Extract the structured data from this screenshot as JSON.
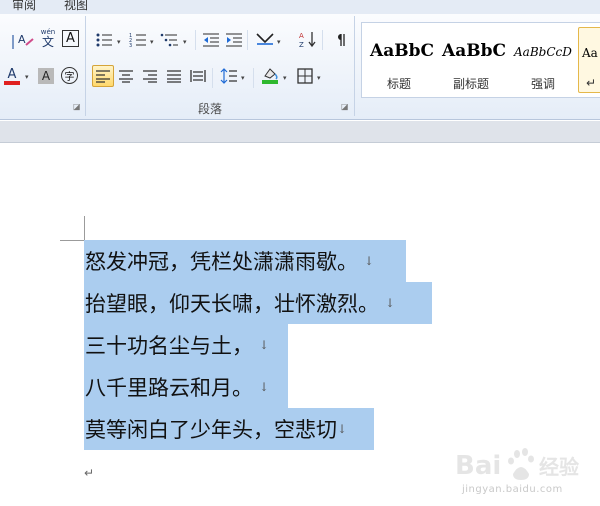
{
  "tabs": {
    "review": "审阅",
    "view": "视图"
  },
  "ribbon": {
    "paragraph_group_label": "段落",
    "font_group_partial": {
      "phonetic_label": "wén",
      "char_border_label": "A",
      "font_color_label": "A",
      "shade_label": "A",
      "enclose_label": "字"
    },
    "font_color_hex": "#e02020",
    "highlight_hex": "#2eb82e"
  },
  "styles": {
    "items": [
      {
        "sample": "AaBbC",
        "name": "标题"
      },
      {
        "sample": "AaBbC",
        "name": "副标题"
      },
      {
        "sample": "AaBbCcD",
        "name": "强调"
      },
      {
        "sample": "Aa",
        "name": "↵"
      }
    ]
  },
  "document": {
    "lines": [
      "怒发冲冠，凭栏处潇潇雨歇。",
      "抬望眼，仰天长啸，壮怀激烈。",
      "三十功名尘与土，",
      "八千里路云和月。",
      "莫等闲白了少年头，空悲切"
    ],
    "paragraph_mark": "↓",
    "end_mark": "↵",
    "selection_color": "#abcdef"
  },
  "watermark": {
    "logo_text": "Bai",
    "brand": "经验",
    "url": "jingyan.baidu.com"
  }
}
